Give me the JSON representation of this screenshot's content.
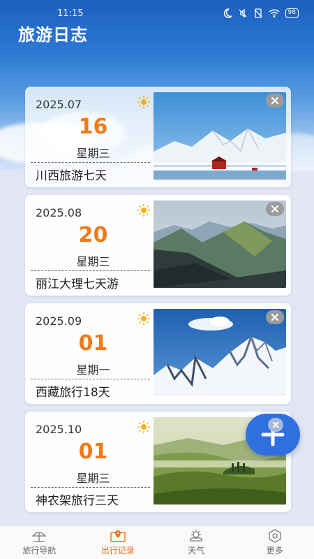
{
  "status_bar": {
    "time": "11:15",
    "battery": "98"
  },
  "app_title": "旅游日志",
  "entries": [
    {
      "year_month": "2025.07",
      "day": "16",
      "weekday": "星期三",
      "title": "川西旅游七天",
      "weather_icon": "sun-icon",
      "photo": "snow-mountain-red-house"
    },
    {
      "year_month": "2025.08",
      "day": "20",
      "weekday": "星期三",
      "title": "丽江大理七天游",
      "weather_icon": "sun-icon",
      "photo": "green-mountain-valley"
    },
    {
      "year_month": "2025.09",
      "day": "01",
      "weekday": "星期一",
      "title": "西藏旅行18天",
      "weather_icon": "sun-icon",
      "photo": "snowy-peaks-blue-sky"
    },
    {
      "year_month": "2025.10",
      "day": "01",
      "weekday": "星期三",
      "title": "神农架旅行三天",
      "weather_icon": "sun-icon",
      "photo": "misty-green-hills"
    }
  ],
  "tabs": [
    {
      "label": "旅行导航",
      "icon": "beach-umbrella-icon",
      "active": false
    },
    {
      "label": "出行记录",
      "icon": "map-pin-icon",
      "active": true
    },
    {
      "label": "天气",
      "icon": "cloud-sun-icon",
      "active": false
    },
    {
      "label": "更多",
      "icon": "hexagon-gear-icon",
      "active": false
    }
  ],
  "colors": {
    "accent": "#f07a1a",
    "fab": "#2f6fde",
    "active_tab": "#e8721a"
  }
}
